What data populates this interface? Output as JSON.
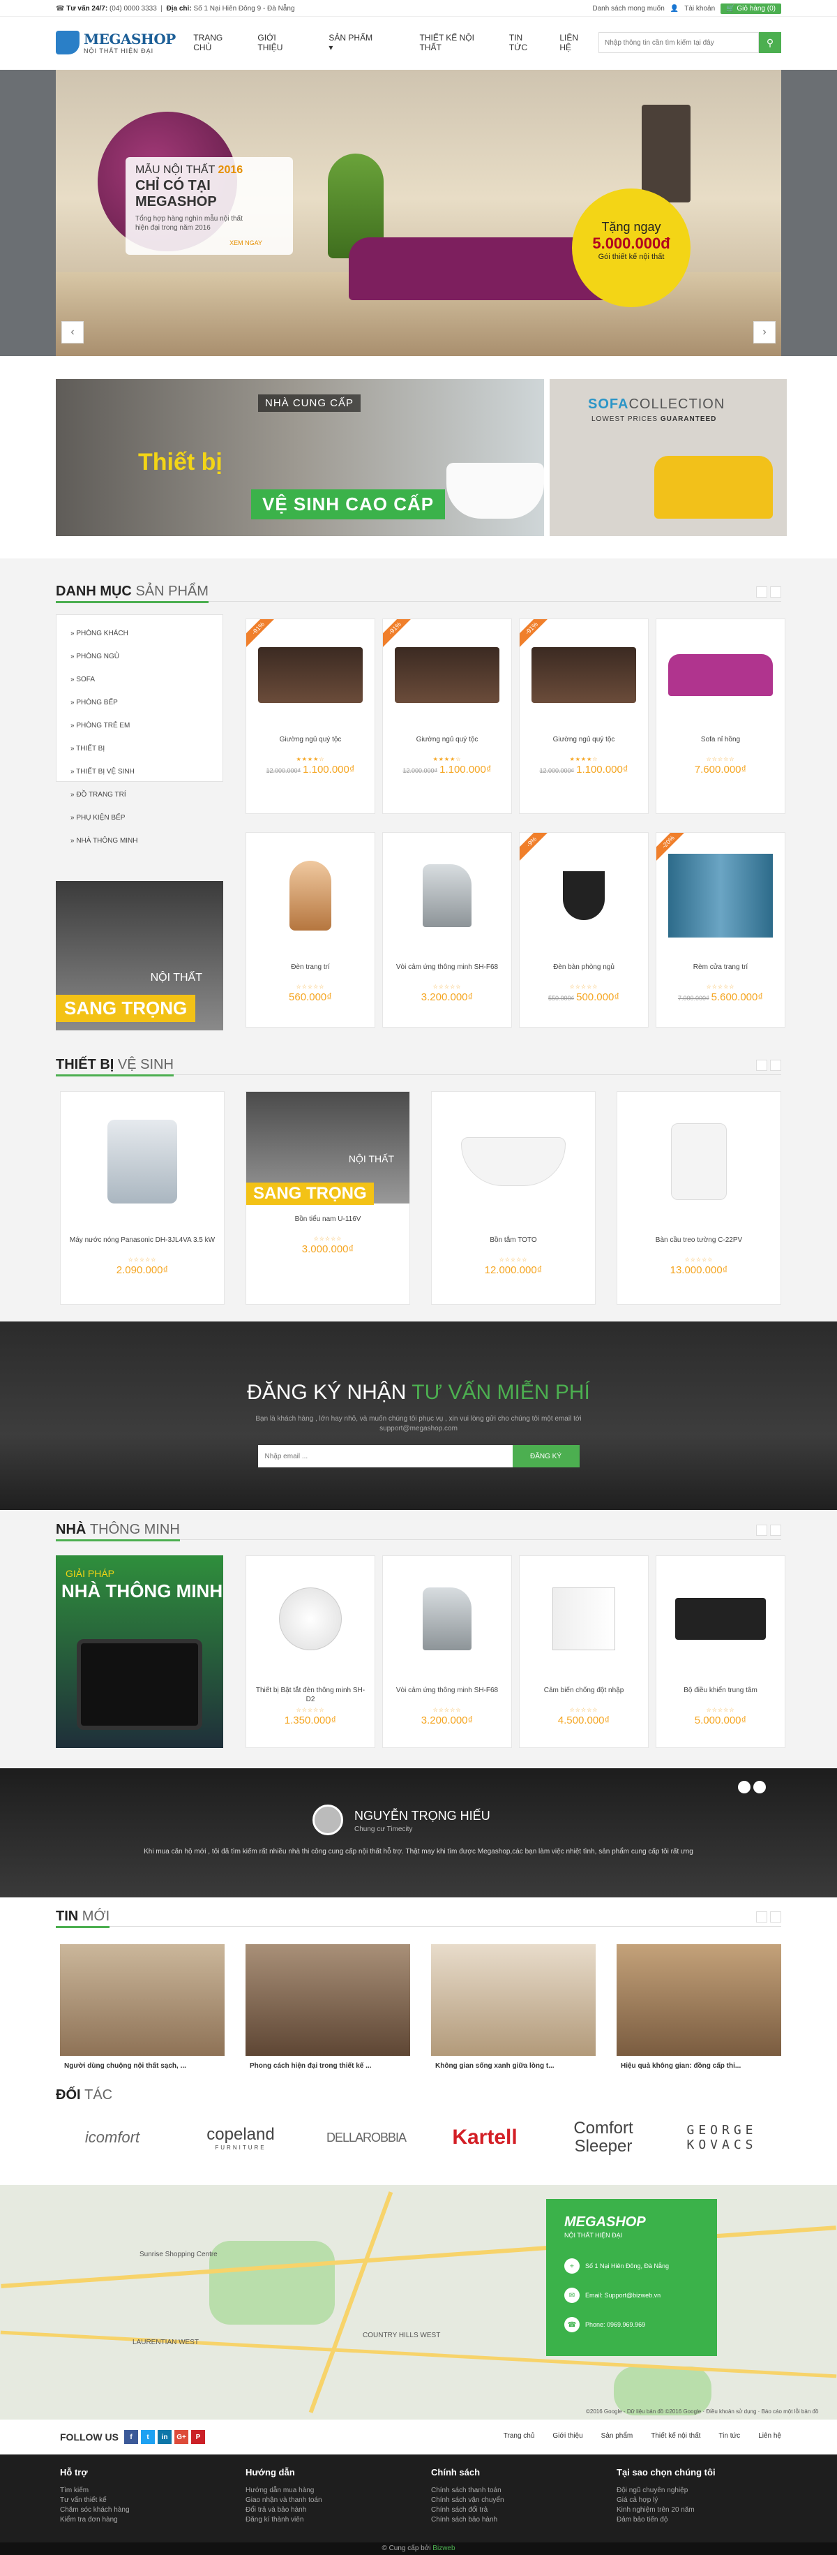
{
  "topbar": {
    "hotline_label": "Tư vấn 24/7:",
    "hotline": "(04) 0000 3333",
    "address_label": "Địa chỉ:",
    "address": "Số 1 Nại Hiên Đông 9 - Đà Nẵng",
    "wishlist": "Danh sách mong muốn",
    "account": "Tài khoản",
    "cart": "Giỏ hàng",
    "cart_count": "0"
  },
  "header": {
    "logo_name": "MEGASHOP",
    "logo_tagline": "NỘI THẤT HIỆN ĐẠI",
    "nav": [
      "TRANG CHỦ",
      "GIỚI THIỆU",
      "SẢN PHẨM",
      "THIẾT KẾ NỘI THẤT",
      "TIN TỨC",
      "LIÊN HỆ"
    ],
    "search_placeholder": "Nhập thông tin cần tìm kiếm tại đây"
  },
  "hero": {
    "line1_prefix": "MẪU NỘI THẤT",
    "line1_year": "2016",
    "line2": "CHỈ CÓ TẠI MEGASHOP",
    "desc": "Tổng hợp hàng nghìn mẫu nội thất hiện đại trong năm 2016",
    "cta": "XEM NGAY",
    "badge_title": "Tặng ngay",
    "badge_amount": "5.000.000đ",
    "badge_note": "Gói thiết kế nội thất",
    "prev": "‹",
    "next": "›"
  },
  "promos": {
    "p1_tag": "NHÀ CUNG CẤP",
    "p1_title": "Thiết bị",
    "p1_sub": "VỆ SINH CAO CẤP",
    "p2_brand": "SOFA",
    "p2_brand2": "COLLECTION",
    "p2_lowest": "LOWEST PRICES",
    "p2_guaranteed": "GUARANTEED"
  },
  "categories": {
    "title": "DANH MỤC",
    "title2": "SẢN PHẨM",
    "items": [
      "» PHÒNG KHÁCH",
      "» PHÒNG NGỦ",
      "» SOFA",
      "» PHÒNG BẾP",
      "» PHÒNG TRẺ EM",
      "» THIẾT BỊ",
      "» THIẾT BỊ VỆ SINH",
      "» ĐỒ TRANG TRÍ",
      "» PHỤ KIỆN BẾP",
      "» NHÀ THÔNG MINH"
    ],
    "banner_small": "NỘI THẤT",
    "banner_big": "SANG TRỌNG"
  },
  "products": [
    {
      "name": "Giường ngủ quý tộc",
      "old": "12.000.000₫",
      "price": "1.100.000₫",
      "sale": "-91%",
      "stars": "★★★★☆"
    },
    {
      "name": "Giường ngủ quý tộc",
      "old": "12.000.000₫",
      "price": "1.100.000₫",
      "sale": "-91%",
      "stars": "★★★★☆"
    },
    {
      "name": "Giường ngủ quý tộc",
      "old": "12.000.000₫",
      "price": "1.100.000₫",
      "sale": "-91%",
      "stars": "★★★★☆"
    },
    {
      "name": "Sofa nỉ hồng",
      "old": "",
      "price": "7.600.000₫",
      "sale": "",
      "stars": "☆☆☆☆☆"
    },
    {
      "name": "Đèn trang trí",
      "old": "",
      "price": "560.000₫",
      "sale": "",
      "stars": "☆☆☆☆☆"
    },
    {
      "name": "Vòi cảm ứng thông minh SH-F68",
      "old": "",
      "price": "3.200.000₫",
      "sale": "",
      "stars": "☆☆☆☆☆"
    },
    {
      "name": "Đèn bàn phòng ngủ",
      "old": "550.000₫",
      "price": "500.000₫",
      "sale": "-9%",
      "stars": "☆☆☆☆☆"
    },
    {
      "name": "Rèm cửa trang trí",
      "old": "7.000.000₫",
      "price": "5.600.000₫",
      "sale": "-20%",
      "stars": "☆☆☆☆☆"
    }
  ],
  "sanitary": {
    "title": "THIẾT BỊ",
    "title2": "VỆ SINH",
    "banner_small": "NỘI THẤT",
    "banner_big": "SANG TRỌNG",
    "items": [
      {
        "name": "Máy nước nóng Panasonic DH-3JL4VA 3.5 kW",
        "price": "2.090.000₫",
        "stars": "☆☆☆☆☆"
      },
      {
        "name": "Bồn tiểu nam U-116V",
        "price": "3.000.000₫",
        "stars": "☆☆☆☆☆"
      },
      {
        "name": "Bồn tắm TOTO",
        "price": "12.000.000₫",
        "stars": "☆☆☆☆☆"
      },
      {
        "name": "Bàn cầu treo tường C-22PV",
        "price": "13.000.000₫",
        "stars": "☆☆☆☆☆"
      }
    ]
  },
  "newsletter": {
    "title": "ĐĂNG KÝ NHẬN",
    "title_hl": "TƯ VẤN MIỄN PHÍ",
    "desc": "Bạn là khách hàng , lớn hay nhỏ, và muốn chúng tôi phục vụ , xin vui lòng gửi cho chúng tôi một email tới support@megashop.com",
    "placeholder": "Nhập email ...",
    "button": "ĐĂNG KÝ"
  },
  "smarthome": {
    "title": "NHÀ",
    "title2": "THÔNG MINH",
    "banner_small": "GIẢI PHÁP",
    "banner_big": "NHÀ THÔNG MINH",
    "items": [
      {
        "name": "Thiết bị Bật tắt đèn thông minh SH-D2",
        "price": "1.350.000₫",
        "stars": "☆☆☆☆☆"
      },
      {
        "name": "Vòi cảm ứng thông minh SH-F68",
        "price": "3.200.000₫",
        "stars": "☆☆☆☆☆"
      },
      {
        "name": "Cảm biến chống đột nhập",
        "price": "4.500.000₫",
        "stars": "☆☆☆☆☆"
      },
      {
        "name": "Bộ điều khiển trung tâm",
        "price": "5.000.000₫",
        "stars": "☆☆☆☆☆"
      }
    ]
  },
  "testimonial": {
    "name": "NGUYỄN TRỌNG HIẾU",
    "role": "Chung cư Timecity",
    "quote": "Khi mua căn hộ mới , tôi đã tìm kiếm rất nhiều nhà thi công cung cấp nội thất hỗ trợ. Thật may khi tìm được Megashop,các bạn làm việc nhiệt tình, sản phẩm cung cấp tôi rất ưng"
  },
  "blog": {
    "title": "TIN",
    "title2": "MỚI",
    "items": [
      "Người dùng chuộng nội thất sạch, ...",
      "Phong cách hiện đại trong thiết kế ...",
      "Không gian sống xanh giữa lòng t...",
      "Hiệu quả không gian: đồng cấp thi..."
    ]
  },
  "partners": {
    "title": "ĐỐI",
    "title2": "TÁC",
    "logos": [
      "icomfort",
      "copeland",
      "FURNITURE",
      "DELLAROBBIA",
      "Kartell",
      "Comfort",
      "Sleeper",
      "GEORGE",
      "KOVACS"
    ]
  },
  "map": {
    "brand": "MEGASHOP",
    "tagline": "NỘI THẤT HIỆN ĐẠI",
    "address": "Số 1 Nại Hiên Đông, Đà Nẵng",
    "email": "Email: Support@bizweb.vn",
    "phone": "Phone: 0969.969.969",
    "labels": [
      "Sunrise Shopping Centre",
      "LAURENTIAN WEST",
      "COUNTRY HILLS WEST"
    ],
    "footer_note": "©2016 Google - Dữ liệu bản đồ ©2016 Google",
    "terms": "Điều khoản sử dụng",
    "report": "Báo cáo một lỗi bản đồ"
  },
  "follow": {
    "label": "FOLLOW US",
    "links": [
      "Trang chủ",
      "Giới thiệu",
      "Sản phẩm",
      "Thiết kế nội thất",
      "Tin tức",
      "Liên hệ"
    ]
  },
  "footer": {
    "cols": [
      {
        "title": "Hỗ trợ",
        "items": [
          "Tìm kiếm",
          "Tư vấn thiết kế",
          "Chăm sóc khách hàng",
          "Kiểm tra đơn hàng"
        ]
      },
      {
        "title": "Hướng dẫn",
        "items": [
          "Hướng dẫn mua hàng",
          "Giao nhận và thanh toán",
          "Đổi trả và bảo hành",
          "Đăng kí thành viên"
        ]
      },
      {
        "title": "Chính sách",
        "items": [
          "Chính sách thanh toán",
          "Chính sách vận chuyển",
          "Chính sách đổi trả",
          "Chính sách bảo hành"
        ]
      },
      {
        "title": "Tại sao chọn chúng tôi",
        "items": [
          "Đội ngũ chuyên nghiệp",
          "Giá cả hợp lý",
          "Kinh nghiệm trên 20 năm",
          "Đảm bảo tiến độ"
        ]
      }
    ],
    "copyright": "© Cung cấp bởi",
    "provider": "Bizweb"
  },
  "colors": {
    "accent": "#4caf50",
    "price": "#f5a623",
    "sale": "#f07f2b",
    "logo": "#1d5f97"
  }
}
